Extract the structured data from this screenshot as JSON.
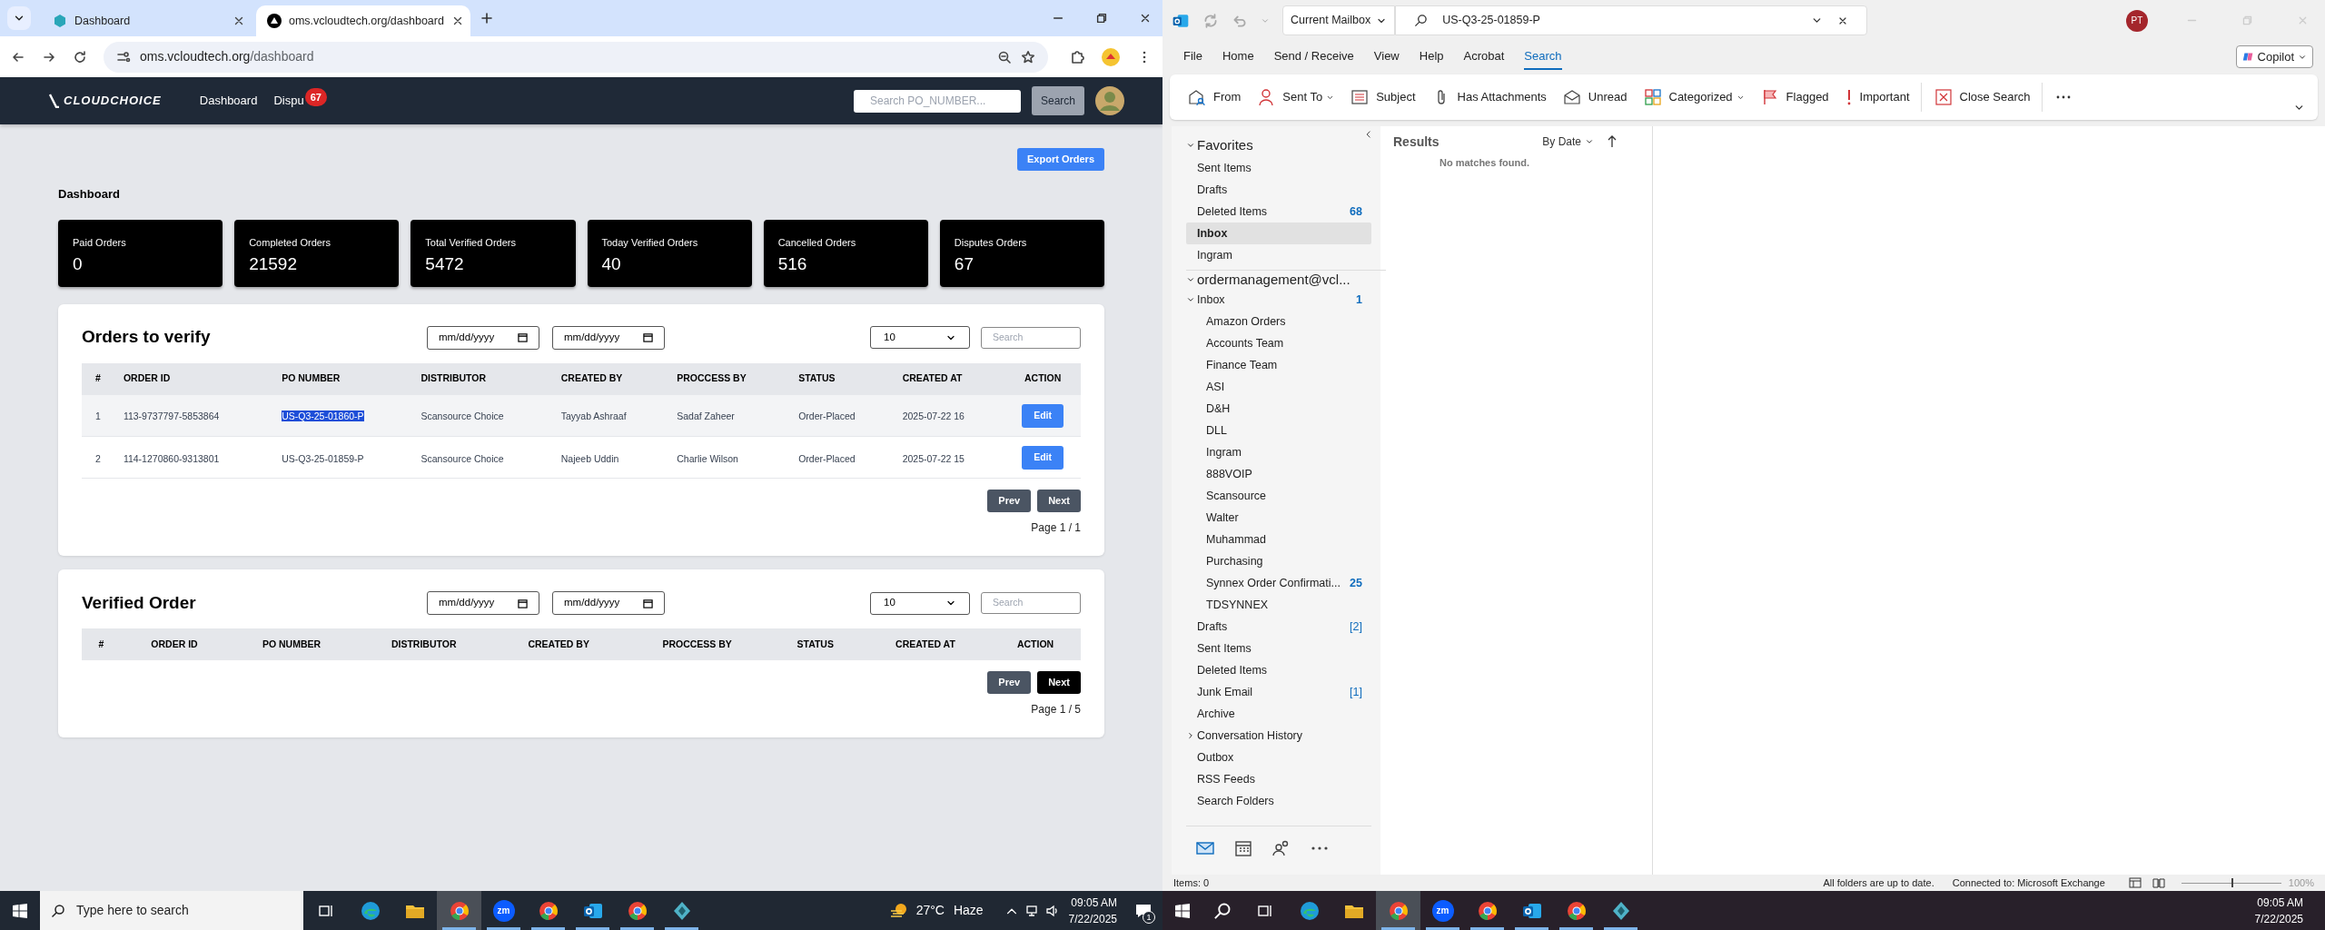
{
  "browser": {
    "tabs": [
      {
        "title": "Dashboard",
        "selected": false
      },
      {
        "title": "oms.vcloudtech.org/dashboard",
        "selected": true
      }
    ],
    "address": {
      "host": "oms.vcloudtech.org",
      "path": "/dashboard"
    }
  },
  "app_header": {
    "logo": "CLOUDCHOICE",
    "nav": [
      {
        "label": "Dashboard"
      },
      {
        "label": "Dispu",
        "badge": "67"
      }
    ],
    "search": {
      "placeholder": "Search PO_NUMBER..."
    },
    "search_button": "Search"
  },
  "export_button": "Export Orders",
  "heading": "Dashboard",
  "stats": [
    {
      "label": "Paid Orders",
      "value": "0"
    },
    {
      "label": "Completed Orders",
      "value": "21592"
    },
    {
      "label": "Total Verified Orders",
      "value": "5472"
    },
    {
      "label": "Today Verified Orders",
      "value": "40"
    },
    {
      "label": "Cancelled Orders",
      "value": "516"
    },
    {
      "label": "Disputes Orders",
      "value": "67"
    }
  ],
  "panels": [
    {
      "title": "Orders to verify",
      "date_fields": [
        {
          "placeholder": "mm/dd/yyyy"
        },
        {
          "placeholder": "mm/dd/yyyy"
        }
      ],
      "page_size": "10",
      "search": {
        "placeholder": "Search"
      },
      "columns": [
        "#",
        "ORDER ID",
        "PO NUMBER",
        "DISTRIBUTOR",
        "CREATED BY",
        "PROCCESS BY",
        "STATUS",
        "CREATED AT",
        "ACTION"
      ],
      "rows": [
        {
          "cells": [
            "1",
            "113-9737797-5853864",
            "US-Q3-25-01860-P",
            "Scansource Choice",
            "Tayyab Ashraaf",
            "Sadaf Zaheer",
            "Order-Placed",
            "2025-07-22 16"
          ],
          "action": "Edit",
          "hovered": true,
          "po_highlighted": true
        },
        {
          "cells": [
            "2",
            "114-1270860-9313801",
            "US-Q3-25-01859-P",
            "Scansource Choice",
            "Najeeb Uddin",
            "Charlie Wilson",
            "Order-Placed",
            "2025-07-22 15"
          ],
          "action": "Edit",
          "hovered": false,
          "po_highlighted": false
        }
      ],
      "prev": "Prev",
      "next": {
        "label": "Next",
        "active": false
      },
      "page": "Page 1 / 1"
    },
    {
      "title": "Verified Order",
      "date_fields": [
        {
          "placeholder": "mm/dd/yyyy"
        },
        {
          "placeholder": "mm/dd/yyyy"
        }
      ],
      "page_size": "10",
      "search": {
        "placeholder": "Search"
      },
      "columns": [
        "#",
        "ORDER ID",
        "PO NUMBER",
        "DISTRIBUTOR",
        "CREATED BY",
        "PROCCESS BY",
        "STATUS",
        "CREATED AT",
        "ACTION"
      ],
      "prev": "Prev",
      "next": {
        "label": "Next",
        "active": true
      },
      "page": "Page 1 / 5"
    }
  ],
  "outlook": {
    "mailbox_scope": "Current Mailbox",
    "search": {
      "value": "US-Q3-25-01859-P"
    },
    "avatar": "PT",
    "menu": [
      {
        "label": "File",
        "selected": false
      },
      {
        "label": "Home",
        "selected": false
      },
      {
        "label": "Send / Receive",
        "selected": false
      },
      {
        "label": "View",
        "selected": false
      },
      {
        "label": "Help",
        "selected": false
      },
      {
        "label": "Acrobat",
        "selected": false
      },
      {
        "label": "Search",
        "selected": true
      }
    ],
    "copilot": "Copilot",
    "ribbon": [
      {
        "kind": "from",
        "label": "From",
        "dropdown": false
      },
      {
        "kind": "sent_to",
        "label": "Sent To",
        "dropdown": true
      },
      {
        "kind": "subject",
        "label": "Subject",
        "dropdown": false
      },
      {
        "kind": "attachment",
        "label": "Has Attachments",
        "dropdown": false
      },
      {
        "kind": "unread",
        "label": "Unread",
        "dropdown": false
      },
      {
        "kind": "categorized",
        "label": "Categorized",
        "dropdown": true
      },
      {
        "kind": "flagged",
        "label": "Flagged",
        "dropdown": false
      },
      {
        "kind": "important",
        "label": "Important",
        "dropdown": false
      },
      {
        "kind": "close",
        "label": "Close Search",
        "dropdown": false
      }
    ],
    "favorites": {
      "title": "Favorites",
      "expanded": true,
      "items": [
        {
          "label": "Sent Items",
          "selected": false
        },
        {
          "label": "Drafts",
          "selected": false
        },
        {
          "label": "Deleted Items",
          "count": "68",
          "selected": false
        },
        {
          "label": "Inbox",
          "selected": true
        },
        {
          "label": "Ingram",
          "selected": false
        }
      ]
    },
    "account": {
      "label": "ordermanagement@vcl...",
      "expanded": true,
      "folders": [
        {
          "label": "Inbox",
          "count": "1",
          "expanded": true,
          "selected": false,
          "children": [
            {
              "label": "Amazon Orders",
              "selected": false
            },
            {
              "label": "Accounts Team",
              "selected": false
            },
            {
              "label": "Finance Team",
              "selected": false
            },
            {
              "label": "ASI",
              "selected": false
            },
            {
              "label": "D&H",
              "selected": false
            },
            {
              "label": "DLL",
              "selected": false
            },
            {
              "label": "Ingram",
              "selected": false
            },
            {
              "label": "888VOIP",
              "selected": false
            },
            {
              "label": "Scansource",
              "selected": false
            },
            {
              "label": "Walter",
              "selected": false
            },
            {
              "label": "Muhammad",
              "selected": false
            },
            {
              "label": "Purchasing",
              "selected": false
            },
            {
              "label": "Synnex Order Confirmati...",
              "count": "25",
              "selected": false
            },
            {
              "label": "TDSYNNEX",
              "selected": false
            }
          ]
        },
        {
          "label": "Drafts",
          "count": "[2]",
          "selected": false
        },
        {
          "label": "Sent Items",
          "selected": false
        },
        {
          "label": "Deleted Items",
          "selected": false
        },
        {
          "label": "Junk Email",
          "count": "[1]",
          "selected": false
        },
        {
          "label": "Archive",
          "selected": false
        },
        {
          "label": "Conversation History",
          "expanded": false,
          "selected": false
        },
        {
          "label": "Outbox",
          "selected": false
        },
        {
          "label": "RSS Feeds",
          "selected": false
        },
        {
          "label": "Search Folders",
          "selected": false
        }
      ]
    },
    "nav_icons": [
      {
        "kind": "mail",
        "selected": true
      },
      {
        "kind": "calendar",
        "selected": false
      },
      {
        "kind": "people",
        "selected": false
      },
      {
        "kind": "more",
        "selected": false
      }
    ],
    "results": {
      "title": "Results",
      "sort": "By Date",
      "empty": "No matches found."
    },
    "status_bar": {
      "items": "Items: 0",
      "sync": "All folders are up to date.",
      "connection": "Connected to: Microsoft Exchange",
      "zoom": {
        "level": 0.5,
        "reading": "100%"
      }
    }
  },
  "taskbars": [
    {
      "search": {
        "placeholder": "Type here to search"
      },
      "apps": [
        {
          "kind": "taskview",
          "running": false,
          "active": false
        },
        {
          "kind": "edge",
          "running": false,
          "active": false
        },
        {
          "kind": "explorer",
          "running": false,
          "active": false
        },
        {
          "kind": "chrome",
          "running": true,
          "active": true
        },
        {
          "kind": "zoom",
          "text": "zm",
          "running": true,
          "active": false
        },
        {
          "kind": "chrome",
          "running": true,
          "active": false
        },
        {
          "kind": "outlook",
          "running": true,
          "active": false
        },
        {
          "kind": "chrome",
          "running": true,
          "active": false
        },
        {
          "kind": "app",
          "running": true,
          "active": false
        }
      ],
      "weather": {
        "temp": "27°C",
        "condition": "Haze"
      },
      "time": "09:05 AM",
      "date": "7/22/2025",
      "notifications": "1"
    },
    {
      "apps": [
        {
          "kind": "taskview",
          "running": false,
          "active": false
        },
        {
          "kind": "edge",
          "running": false,
          "active": false
        },
        {
          "kind": "explorer",
          "running": false,
          "active": false
        },
        {
          "kind": "chrome",
          "running": true,
          "active": true
        },
        {
          "kind": "zoom",
          "text": "zm",
          "running": true,
          "active": false
        },
        {
          "kind": "chrome",
          "running": true,
          "active": false
        },
        {
          "kind": "outlook",
          "running": true,
          "active": false
        },
        {
          "kind": "chrome",
          "running": true,
          "active": false
        },
        {
          "kind": "app",
          "running": true,
          "active": false
        }
      ],
      "time": "09:05 AM",
      "date": "7/22/2025"
    }
  ]
}
